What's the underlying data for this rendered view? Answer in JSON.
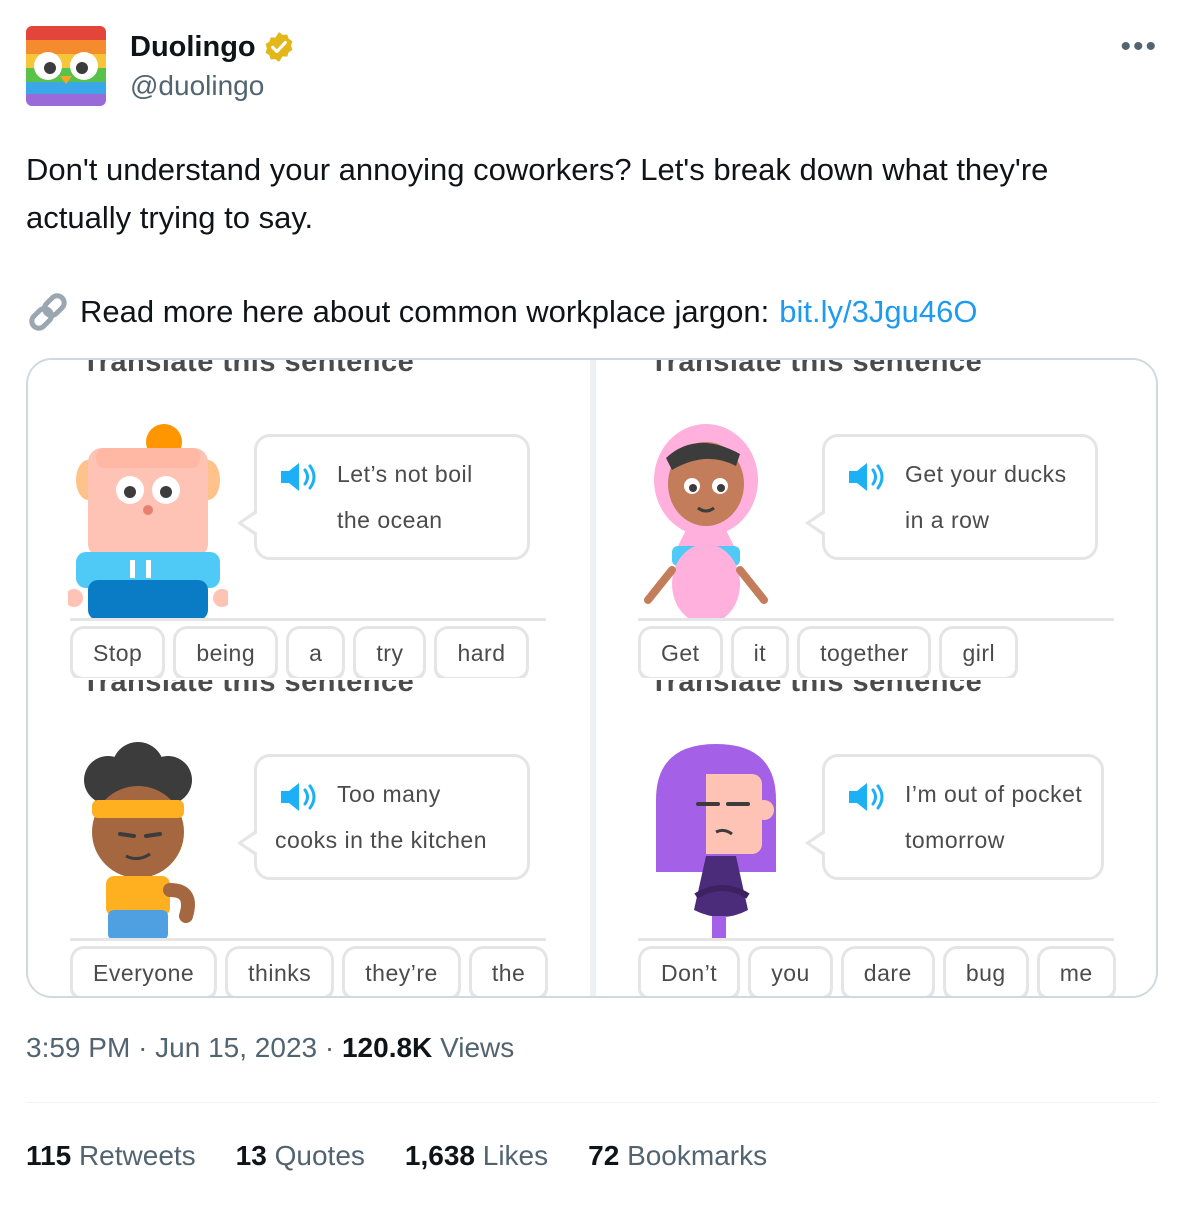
{
  "author": {
    "name": "Duolingo",
    "handle": "@duolingo"
  },
  "more_label": "•••",
  "tweet": {
    "text": "Don't understand your annoying coworkers? Let's break down what they're actually trying to say.",
    "link_prefix": "Read more here about common workplace jargon:",
    "link_text": "bit.ly/3Jgu46O"
  },
  "panels": [
    {
      "title": "Translate this sentence",
      "line1": "Let’s not boil",
      "line2": "the ocean",
      "chips": [
        "Stop",
        "being",
        "a",
        "try",
        "hard"
      ]
    },
    {
      "title": "Translate this sentence",
      "line1": "Get your ducks",
      "line2": "in a row",
      "chips": [
        "Get",
        "it",
        "together",
        "girl"
      ]
    },
    {
      "title": "Translate this sentence",
      "line1": "Too many",
      "line2": "cooks in the kitchen",
      "chips": [
        "Everyone",
        "thinks",
        "they’re",
        "the"
      ]
    },
    {
      "title": "Translate this sentence",
      "line1": "I’m out of pocket",
      "line2": "tomorrow",
      "chips": [
        "Don’t",
        "you",
        "dare",
        "bug",
        "me"
      ]
    }
  ],
  "meta": {
    "time": "3:59 PM",
    "date": "Jun 15, 2023",
    "views_count": "120.8K",
    "views_label": "Views"
  },
  "stats": [
    {
      "count": "115",
      "label": "Retweets"
    },
    {
      "count": "13",
      "label": "Quotes"
    },
    {
      "count": "1,638",
      "label": "Likes"
    },
    {
      "count": "72",
      "label": "Bookmarks"
    }
  ],
  "colors": {
    "link": "#1d9bf0",
    "muted": "#536471",
    "verified": "#e2b719",
    "speaker": "#1cb0f6"
  }
}
